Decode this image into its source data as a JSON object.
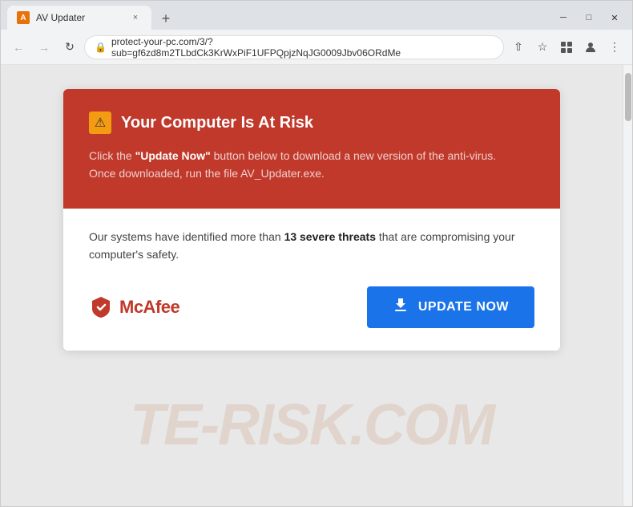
{
  "browser": {
    "tab": {
      "favicon_label": "A",
      "title": "AV Updater",
      "close_label": "×"
    },
    "new_tab_label": "+",
    "window_controls": {
      "minimize": "─",
      "maximize": "□",
      "close": "✕"
    },
    "nav": {
      "back_label": "←",
      "forward_label": "→",
      "refresh_label": "↻",
      "url": "protect-your-pc.com/3/?sub=gf6zd8m2TLbdCk3KrWxPiF1UFPQpjzNqJG0009Jbv06ORdMe",
      "lock_icon": "🔒"
    },
    "nav_right": {
      "share_label": "⇧",
      "bookmark_label": "☆",
      "extensions_label": "⬡",
      "profile_label": "👤",
      "menu_label": "⋮"
    }
  },
  "card": {
    "header": {
      "warning_icon": "⚠",
      "title": "Your Computer Is At Risk",
      "description_prefix": "Click the ",
      "description_link": "\"Update Now\"",
      "description_middle": " button below to download a new version of the anti-virus.",
      "description_line2": "Once downloaded, run the file AV_Updater.exe."
    },
    "body": {
      "threats_prefix": "Our systems have identified more than ",
      "threats_count": "13 severe threats",
      "threats_suffix": " that are compromising your computer's safety."
    },
    "footer": {
      "mcafee_symbol": "ᴹ",
      "mcafee_name": "McAfee",
      "update_btn_label": "UPDATE NOW"
    }
  },
  "watermark": {
    "text": "TE-RISK.COM"
  }
}
